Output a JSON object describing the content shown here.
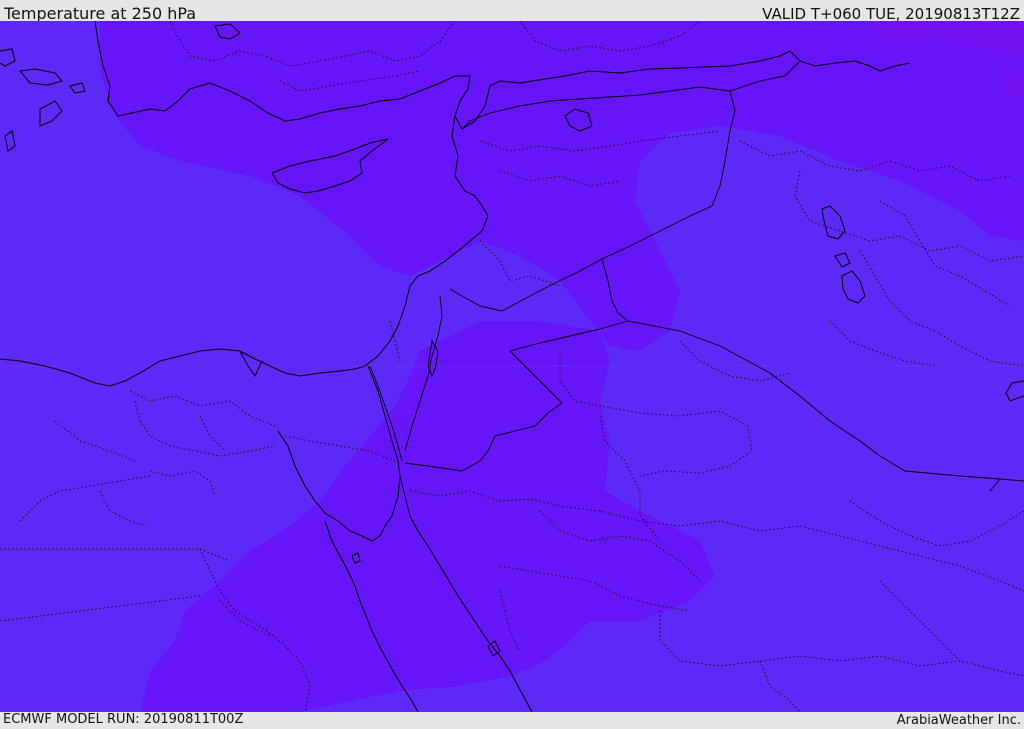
{
  "header": {
    "title": "Temperature at 250 hPa",
    "valid_time": "VALID T+060 TUE, 20190813T12Z"
  },
  "footer": {
    "model_run": "ECMWF MODEL RUN: 20190811T00Z",
    "credit": "ArabiaWeather Inc."
  },
  "colors": {
    "base_field": "#5c29f7",
    "warm_field": "#6615f8",
    "warmer_field": "#7110f0",
    "lines": "#000000",
    "frame": "#e6e6e6"
  }
}
